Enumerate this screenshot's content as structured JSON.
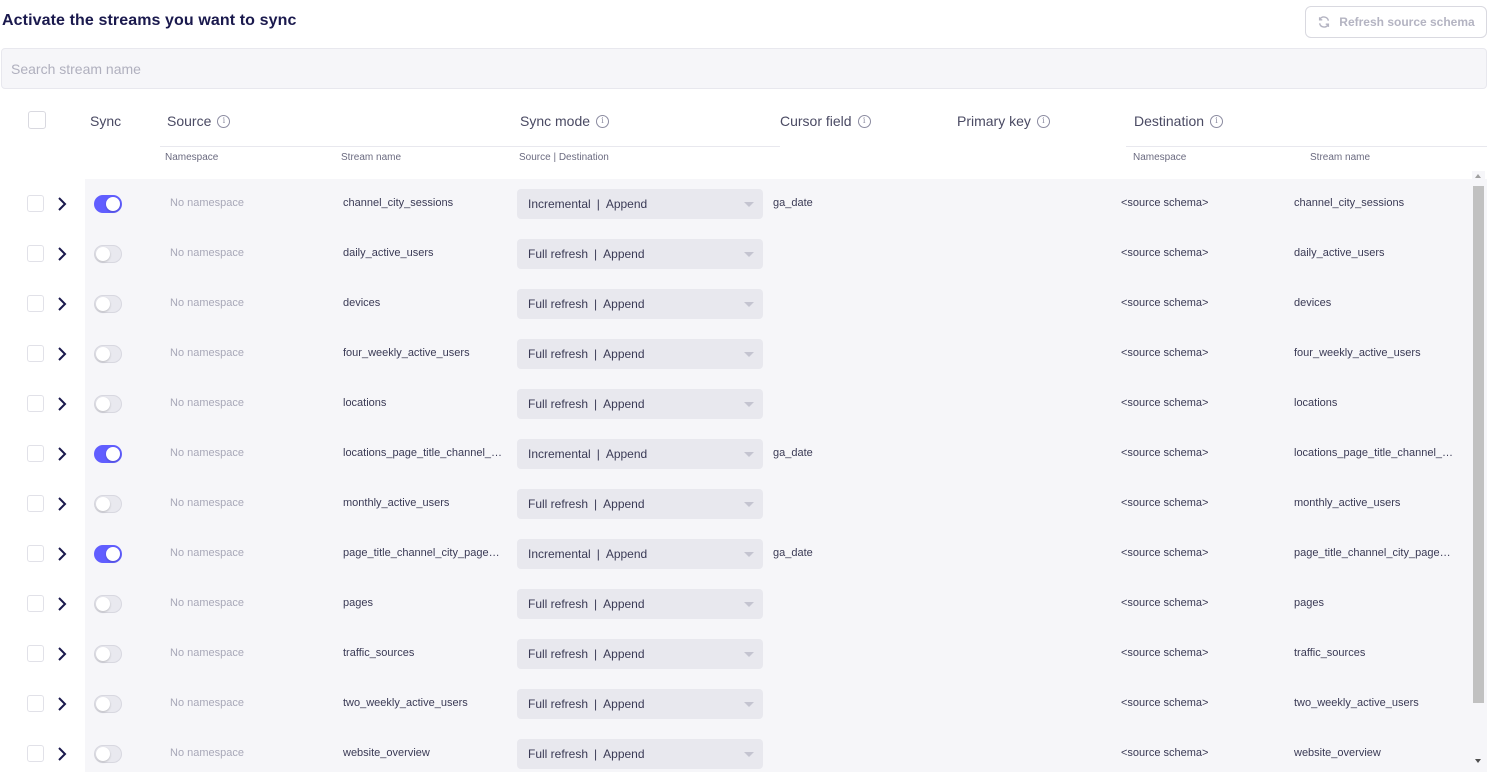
{
  "title": "Activate the streams you want to sync",
  "refresh_button": {
    "label": "Refresh source schema",
    "icon": "refresh-icon"
  },
  "search": {
    "placeholder": "Search stream name",
    "value": ""
  },
  "headers": {
    "sync": "Sync",
    "source": "Source",
    "sync_mode": "Sync mode",
    "cursor_field": "Cursor field",
    "primary_key": "Primary key",
    "destination": "Destination"
  },
  "subheaders": {
    "source_namespace": "Namespace",
    "source_stream_name": "Stream name",
    "sync_mode": "Source | Destination",
    "dest_namespace": "Namespace",
    "dest_stream_name": "Stream name"
  },
  "colors": {
    "accent": "#615eff",
    "title": "#1a194d",
    "row_bg": "#f6f6f9"
  },
  "rows": [
    {
      "sync": true,
      "namespace": "No namespace",
      "stream": "channel_city_sessions",
      "mode_source": "Incremental",
      "mode_dest": "Append",
      "cursor": "ga_date",
      "dest_namespace": "<source schema>",
      "dest_stream": "channel_city_sessions"
    },
    {
      "sync": false,
      "namespace": "No namespace",
      "stream": "daily_active_users",
      "mode_source": "Full refresh",
      "mode_dest": "Append",
      "cursor": "",
      "dest_namespace": "<source schema>",
      "dest_stream": "daily_active_users"
    },
    {
      "sync": false,
      "namespace": "No namespace",
      "stream": "devices",
      "mode_source": "Full refresh",
      "mode_dest": "Append",
      "cursor": "",
      "dest_namespace": "<source schema>",
      "dest_stream": "devices"
    },
    {
      "sync": false,
      "namespace": "No namespace",
      "stream": "four_weekly_active_users",
      "mode_source": "Full refresh",
      "mode_dest": "Append",
      "cursor": "",
      "dest_namespace": "<source schema>",
      "dest_stream": "four_weekly_active_users"
    },
    {
      "sync": false,
      "namespace": "No namespace",
      "stream": "locations",
      "mode_source": "Full refresh",
      "mode_dest": "Append",
      "cursor": "",
      "dest_namespace": "<source schema>",
      "dest_stream": "locations"
    },
    {
      "sync": true,
      "namespace": "No namespace",
      "stream": "locations_page_title_channel_cit...",
      "mode_source": "Incremental",
      "mode_dest": "Append",
      "cursor": "ga_date",
      "dest_namespace": "<source schema>",
      "dest_stream": "locations_page_title_channel_cit..."
    },
    {
      "sync": false,
      "namespace": "No namespace",
      "stream": "monthly_active_users",
      "mode_source": "Full refresh",
      "mode_dest": "Append",
      "cursor": "",
      "dest_namespace": "<source schema>",
      "dest_stream": "monthly_active_users"
    },
    {
      "sync": true,
      "namespace": "No namespace",
      "stream": "page_title_channel_city_pagevie...",
      "mode_source": "Incremental",
      "mode_dest": "Append",
      "cursor": "ga_date",
      "dest_namespace": "<source schema>",
      "dest_stream": "page_title_channel_city_pagevie..."
    },
    {
      "sync": false,
      "namespace": "No namespace",
      "stream": "pages",
      "mode_source": "Full refresh",
      "mode_dest": "Append",
      "cursor": "",
      "dest_namespace": "<source schema>",
      "dest_stream": "pages"
    },
    {
      "sync": false,
      "namespace": "No namespace",
      "stream": "traffic_sources",
      "mode_source": "Full refresh",
      "mode_dest": "Append",
      "cursor": "",
      "dest_namespace": "<source schema>",
      "dest_stream": "traffic_sources"
    },
    {
      "sync": false,
      "namespace": "No namespace",
      "stream": "two_weekly_active_users",
      "mode_source": "Full refresh",
      "mode_dest": "Append",
      "cursor": "",
      "dest_namespace": "<source schema>",
      "dest_stream": "two_weekly_active_users"
    },
    {
      "sync": false,
      "namespace": "No namespace",
      "stream": "website_overview",
      "mode_source": "Full refresh",
      "mode_dest": "Append",
      "cursor": "",
      "dest_namespace": "<source schema>",
      "dest_stream": "website_overview"
    }
  ]
}
